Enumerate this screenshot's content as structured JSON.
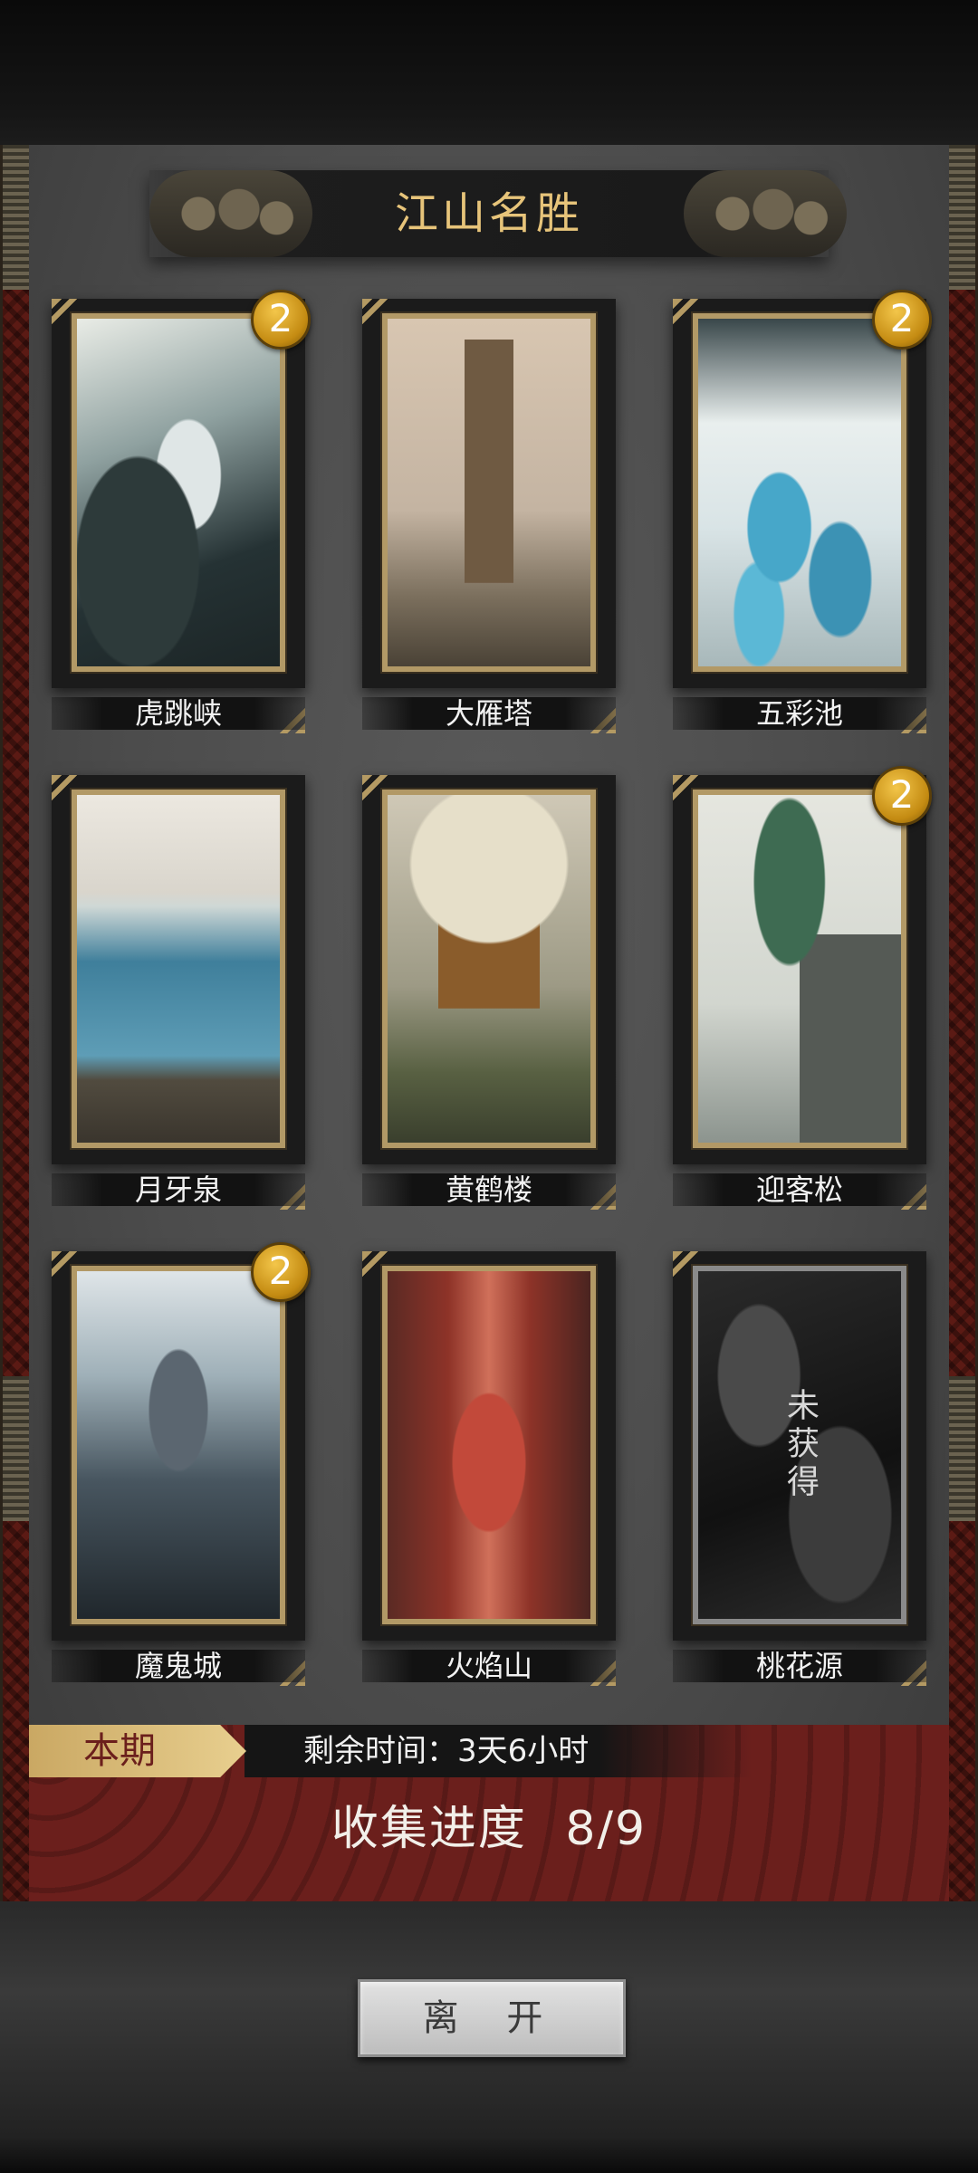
{
  "title": "江山名胜",
  "cards": [
    {
      "name": "虎跳峡",
      "badge": "2"
    },
    {
      "name": "大雁塔",
      "badge": ""
    },
    {
      "name": "五彩池",
      "badge": "2"
    },
    {
      "name": "月牙泉",
      "badge": ""
    },
    {
      "name": "黄鹤楼",
      "badge": ""
    },
    {
      "name": "迎客松",
      "badge": "2"
    },
    {
      "name": "魔鬼城",
      "badge": "2"
    },
    {
      "name": "火焰山",
      "badge": ""
    },
    {
      "name": "桃花源",
      "badge": "",
      "locked_text": "未获得"
    }
  ],
  "period": {
    "tag": "本期",
    "remaining_time": "剩余时间：3天6小时"
  },
  "progress": {
    "label": "收集进度",
    "value": "8/9"
  },
  "leave_button": "离 开",
  "colors": {
    "title_gold": "#e7c47a",
    "badge_gold": "#e0a826",
    "progress_red": "#6b1f1c"
  }
}
